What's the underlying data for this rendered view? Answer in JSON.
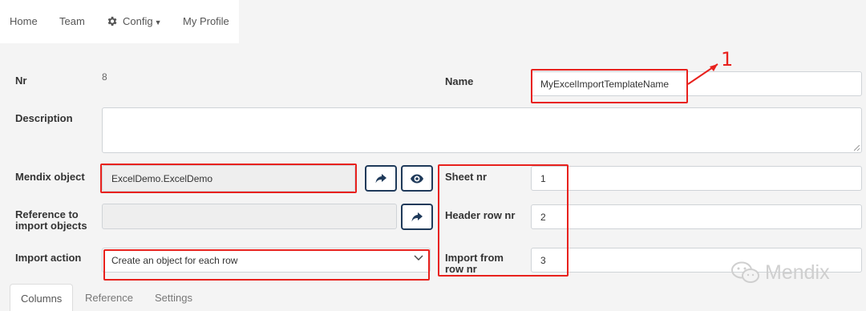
{
  "nav": {
    "home": "Home",
    "team": "Team",
    "config": "Config",
    "profile": "My Profile"
  },
  "form": {
    "nr_label": "Nr",
    "nr_value": "8",
    "name_label": "Name",
    "name_value": "MyExcelImportTemplateName",
    "description_label": "Description",
    "description_value": "",
    "mendix_object_label": "Mendix object",
    "mendix_object_value": "ExcelDemo.ExcelDemo",
    "reference_label_line1": "Reference to",
    "reference_label_line2": "import objects",
    "reference_value": "",
    "import_action_label": "Import action",
    "import_action_value": "Create an object for each row",
    "sheet_nr_label": "Sheet nr",
    "sheet_nr_value": "1",
    "header_row_label": "Header row nr",
    "header_row_value": "2",
    "import_from_label_line1": "Import from",
    "import_from_label_line2": "row nr",
    "import_from_value": "3"
  },
  "annotation": {
    "number": "1"
  },
  "tabs": [
    "Columns",
    "Reference",
    "Settings"
  ],
  "watermark": {
    "text": "Mendix"
  },
  "colors": {
    "annotation_red": "#e8211d",
    "button_border": "#1f3a5a",
    "background": "#f4f4f4"
  },
  "icons": [
    "gear-icon",
    "caret-down-icon",
    "share-arrow-icon",
    "eye-icon",
    "chevron-down-icon",
    "wechat-icon"
  ]
}
